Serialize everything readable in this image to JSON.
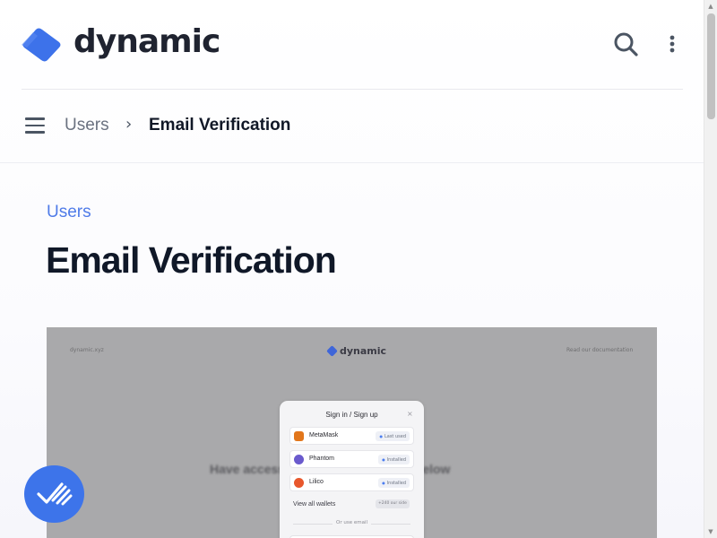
{
  "header": {
    "brand": "dynamic",
    "logo_icon": "dynamic-logo-icon",
    "search_icon": "search-icon",
    "more_icon": "more-vertical-icon"
  },
  "breadcrumb": {
    "menu_icon": "hamburger-menu-icon",
    "parent": "Users",
    "separator": "›",
    "current": "Email Verification"
  },
  "main": {
    "eyebrow": "Users",
    "title": "Email Verification",
    "accent_color": "#4f7be8"
  },
  "screenshot": {
    "top_left": "dynamic.xyz",
    "logo_text": "dynamic",
    "top_right": "Read our documentation",
    "blurred_text": "Have access? Verify by signing in below",
    "modal": {
      "title": "Sign in / Sign up",
      "close": "×",
      "wallets": [
        {
          "name": "MetaMask",
          "badge": "Last used",
          "icon": "metamask-fox-icon",
          "color": "#e2761b"
        },
        {
          "name": "Phantom",
          "badge": "Installed",
          "icon": "phantom-ghost-icon",
          "color": "#6a5acd"
        },
        {
          "name": "Lilico",
          "badge": "Installed",
          "icon": "lilico-icon",
          "color": "#e8572c"
        }
      ],
      "view_all": "View all wallets",
      "view_all_badge": "+240 our side",
      "or_text": "Or use email"
    }
  },
  "fab": {
    "icon": "help-chat-icon",
    "color": "#3d74ea"
  },
  "scrollbar": {
    "up_icon": "▲",
    "down_icon": "▼"
  }
}
